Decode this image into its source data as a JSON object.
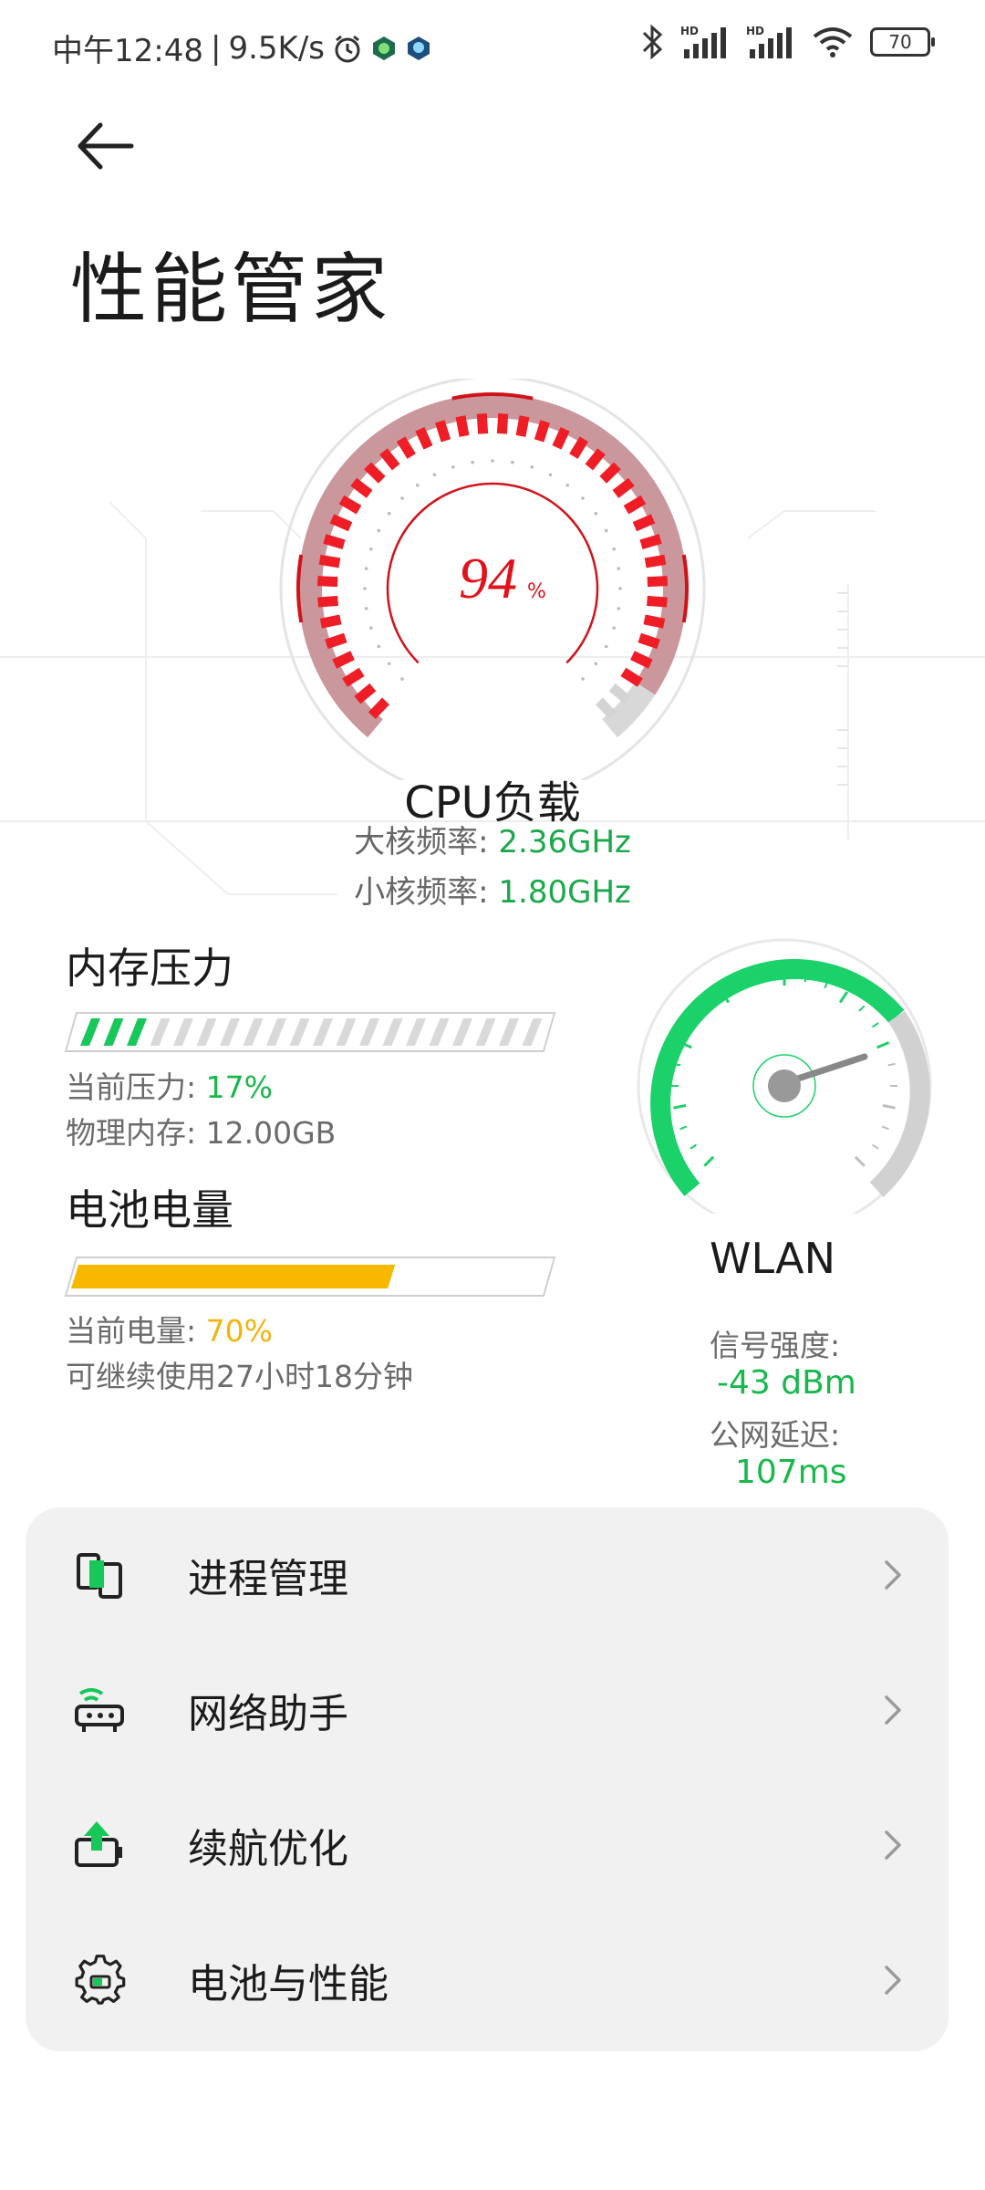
{
  "status_bar": {
    "time": "中午12:48",
    "speed": "9.5K/s",
    "battery": "70"
  },
  "header": {
    "back_icon": "arrow-left-icon",
    "title": "性能管家"
  },
  "cpu": {
    "load_percent": 94,
    "load_value": "94",
    "load_unit": "%",
    "label": "CPU负载",
    "big_core_label": "大核频率:",
    "big_core_value": "2.36GHz",
    "small_core_label": "小核频率:",
    "small_core_value": "1.80GHz"
  },
  "memory": {
    "title": "内存压力",
    "pressure_fraction": 0.17,
    "pressure_label": "当前压力:",
    "pressure_value": "17%",
    "physical_label": "物理内存:",
    "physical_value": "12.00GB"
  },
  "battery": {
    "title": "电池电量",
    "level_fraction": 0.7,
    "level_label": "当前电量:",
    "level_value": "70%",
    "remaining": "可继续使用27小时18分钟"
  },
  "wlan": {
    "label": "WLAN",
    "signal_label": "信号强度:",
    "signal_value": "-43 dBm",
    "latency_label": "公网延迟:",
    "latency_value": "107ms"
  },
  "menu": {
    "items": [
      {
        "label": "进程管理",
        "icon": "process-icon"
      },
      {
        "label": "网络助手",
        "icon": "router-icon"
      },
      {
        "label": "续航优化",
        "icon": "battery-boost-icon"
      },
      {
        "label": "电池与性能",
        "icon": "gear-icon"
      }
    ]
  },
  "colors": {
    "accent_green": "#18b84c",
    "cpu_red": "#e0121b",
    "battery_yellow": "#f9b800"
  }
}
